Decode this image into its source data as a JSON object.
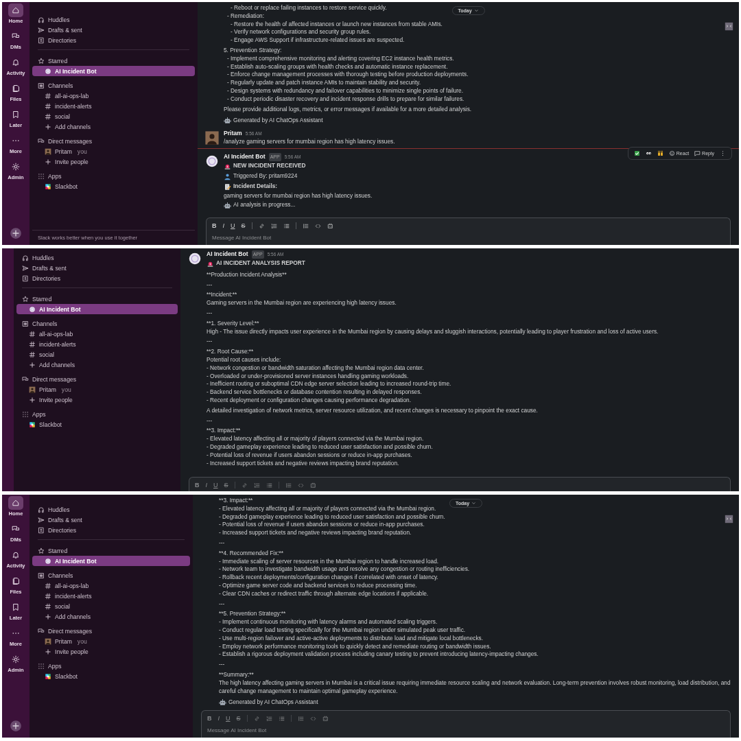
{
  "panels": [
    {
      "rail": [
        {
          "label": "Home",
          "kind": "home",
          "selected": true
        },
        {
          "label": "DMs",
          "kind": "dms",
          "selected": false
        },
        {
          "label": "Activity",
          "kind": "activity",
          "selected": false
        },
        {
          "label": "Files",
          "kind": "files",
          "selected": false
        },
        {
          "label": "Later",
          "kind": "later",
          "selected": false
        },
        {
          "label": "More",
          "kind": "more",
          "selected": false
        },
        {
          "label": "Admin",
          "kind": "admin",
          "selected": false
        }
      ],
      "sidebar": {
        "nav": [
          {
            "label": "Huddles",
            "kind": "huddles"
          },
          {
            "label": "Drafts & sent",
            "kind": "drafts"
          },
          {
            "label": "Directories",
            "kind": "directories"
          }
        ],
        "sections": [
          {
            "title": "Starred",
            "kind": "starred",
            "items": [
              {
                "label": "AI Incident Bot",
                "kind": "bot",
                "selected": true
              }
            ]
          },
          {
            "title": "Channels",
            "kind": "channels",
            "items": [
              {
                "label": "all-ai-ops-lab",
                "kind": "channel",
                "selected": false
              },
              {
                "label": "incident-alerts",
                "kind": "channel",
                "selected": false
              },
              {
                "label": "social",
                "kind": "channel",
                "selected": false
              },
              {
                "label": "Add channels",
                "kind": "add",
                "selected": false
              }
            ]
          },
          {
            "title": "Direct messages",
            "kind": "dms",
            "items": [
              {
                "label": "Pritam",
                "suffix": "you",
                "kind": "user",
                "selected": false
              },
              {
                "label": "Invite people",
                "kind": "add",
                "selected": false
              }
            ]
          },
          {
            "title": "Apps",
            "kind": "apps",
            "items": [
              {
                "label": "Slackbot",
                "kind": "app",
                "selected": false
              }
            ]
          }
        ],
        "footer": "Slack works better when you use it together"
      },
      "main": {
        "today": "Today",
        "side_button": true,
        "messages": [
          {
            "blocks": [
              {
                "lines": [
                  {
                    "text": "- Reboot or replace failing instances to restore service quickly.",
                    "kind": "subitem"
                  },
                  {
                    "text": "- Remediation:",
                    "kind": "item"
                  },
                  {
                    "text": "- Restore the health of affected instances or launch new instances from stable AMIs.",
                    "kind": "subitem"
                  },
                  {
                    "text": "- Verify network configurations and security group rules.",
                    "kind": "subitem"
                  },
                  {
                    "text": "- Engage AWS Support if infrastructure-related issues are suspected.",
                    "kind": "subitem"
                  }
                ]
              },
              {
                "lines": [
                  {
                    "text": "5. Prevention Strategy:",
                    "kind": "text"
                  },
                  {
                    "text": "- Implement comprehensive monitoring and alerting covering EC2 instance health metrics.",
                    "kind": "item"
                  },
                  {
                    "text": "- Establish auto-scaling groups with health checks and automatic instance replacement.",
                    "kind": "item"
                  },
                  {
                    "text": "- Enforce change management processes with thorough testing before production deployments.",
                    "kind": "item"
                  },
                  {
                    "text": "- Regularly update and patch instance AMIs to maintain stability and security.",
                    "kind": "item"
                  },
                  {
                    "text": "- Design systems with redundancy and failover capabilities to minimize single points of failure.",
                    "kind": "item"
                  },
                  {
                    "text": "- Conduct periodic disaster recovery and incident response drills to prepare for similar failures.",
                    "kind": "item"
                  }
                ]
              },
              {
                "lines": [
                  {
                    "text": "Please provide additional logs, metrics, or error messages if available for a more detailed analysis.",
                    "kind": "text"
                  }
                ]
              },
              {
                "lines": [
                  {
                    "text": "Generated by AI ChatOps Assistant",
                    "kind": "note"
                  }
                ]
              }
            ]
          },
          {
            "author": "Pritam",
            "kind": "user",
            "time": "5:56 AM",
            "new_divider": true,
            "blocks": [
              {
                "lines": [
                  {
                    "text": "/analyze gaming servers for mumbai region has high latency issues.",
                    "kind": "text"
                  }
                ]
              }
            ]
          },
          {
            "author": "AI Incident Bot",
            "badge": "APP",
            "kind": "bot",
            "time": "5:56 AM",
            "blocks": [
              {
                "lines": [
                  {
                    "text": "NEW INCIDENT RECEIVED",
                    "kind": "alert"
                  },
                  {
                    "text": "Triggered By: pritam9224",
                    "kind": "trigger"
                  },
                  {
                    "text": "Incident Details:",
                    "kind": "details"
                  },
                  {
                    "text": "gaming servers for mumbai region has high latency issues.",
                    "kind": "text"
                  },
                  {
                    "text": "AI analysis in progress...",
                    "kind": "note"
                  }
                ]
              }
            ],
            "actions": [
              {
                "kind": "check"
              },
              {
                "kind": "eyes"
              },
              {
                "kind": "hands"
              },
              {
                "kind": "react",
                "label": "React"
              },
              {
                "kind": "reply",
                "label": "Reply"
              },
              {
                "kind": "kebab"
              }
            ]
          }
        ],
        "composer": {
          "disabled": false,
          "placeholder": "Message AI Incident Bot",
          "tools": [
            {
              "kind": "bold",
              "label": "B"
            },
            {
              "kind": "italic",
              "label": "I"
            },
            {
              "kind": "underline",
              "label": "U"
            },
            {
              "kind": "strike",
              "label": "S"
            },
            {
              "kind": "link"
            },
            {
              "kind": "olist"
            },
            {
              "kind": "ulist"
            },
            {
              "kind": "quote"
            },
            {
              "kind": "code"
            },
            {
              "kind": "codeblock"
            }
          ]
        }
      }
    },
    {
      "sidebar": {
        "nav": [
          {
            "label": "Huddles",
            "kind": "huddles"
          },
          {
            "label": "Drafts & sent",
            "kind": "drafts"
          },
          {
            "label": "Directories",
            "kind": "directories"
          }
        ],
        "sections": [
          {
            "title": "Starred",
            "kind": "starred",
            "items": [
              {
                "label": "AI Incident Bot",
                "kind": "bot",
                "selected": true
              }
            ]
          },
          {
            "title": "Channels",
            "kind": "channels",
            "items": [
              {
                "label": "all-ai-ops-lab",
                "kind": "channel",
                "selected": false
              },
              {
                "label": "incident-alerts",
                "kind": "channel",
                "selected": false
              },
              {
                "label": "social",
                "kind": "channel",
                "selected": false
              },
              {
                "label": "Add channels",
                "kind": "add",
                "selected": false
              }
            ]
          },
          {
            "title": "Direct messages",
            "kind": "dms",
            "items": [
              {
                "label": "Pritam",
                "suffix": "you",
                "kind": "user",
                "selected": false
              },
              {
                "label": "Invite people",
                "kind": "add",
                "selected": false
              }
            ]
          },
          {
            "title": "Apps",
            "kind": "apps",
            "items": [
              {
                "label": "Slackbot",
                "kind": "app",
                "selected": false
              }
            ]
          }
        ]
      },
      "main": {
        "messages": [
          {
            "author": "AI Incident Bot",
            "badge": "APP",
            "kind": "bot",
            "time": "5:56 AM",
            "blocks": [
              {
                "lines": [
                  {
                    "text": "AI INCIDENT ANALYSIS REPORT",
                    "kind": "alert"
                  }
                ]
              },
              {
                "lines": [
                  {
                    "text": "**Production Incident Analysis**",
                    "kind": "text"
                  }
                ]
              },
              {
                "lines": [
                  {
                    "text": "---",
                    "kind": "text"
                  }
                ]
              },
              {
                "lines": [
                  {
                    "text": "**Incident:**",
                    "kind": "text"
                  },
                  {
                    "text": "Gaming servers in the Mumbai region are experiencing high latency issues.",
                    "kind": "text"
                  }
                ]
              },
              {
                "lines": [
                  {
                    "text": "---",
                    "kind": "text"
                  }
                ]
              },
              {
                "lines": [
                  {
                    "text": "**1. Severity Level:**",
                    "kind": "text"
                  },
                  {
                    "text": "High - The issue directly impacts user experience in the Mumbai region by causing delays and sluggish interactions, potentially leading to player frustration and loss of active users.",
                    "kind": "text"
                  }
                ]
              },
              {
                "lines": [
                  {
                    "text": "---",
                    "kind": "text"
                  }
                ]
              },
              {
                "lines": [
                  {
                    "text": "**2. Root Cause:**",
                    "kind": "text"
                  },
                  {
                    "text": "Potential root causes include:",
                    "kind": "text"
                  },
                  {
                    "text": "- Network congestion or bandwidth saturation affecting the Mumbai region data center.",
                    "kind": "text"
                  },
                  {
                    "text": "- Overloaded or under-provisioned server instances handling gaming workloads.",
                    "kind": "text"
                  },
                  {
                    "text": "- Inefficient routing or suboptimal CDN edge server selection leading to increased round-trip time.",
                    "kind": "text"
                  },
                  {
                    "text": "- Backend service bottlenecks or database contention resulting in delayed responses.",
                    "kind": "text"
                  },
                  {
                    "text": "- Recent deployment or configuration changes causing performance degradation.",
                    "kind": "text"
                  }
                ]
              },
              {
                "lines": [
                  {
                    "text": "A detailed investigation of network metrics, server resource utilization, and recent changes is necessary to pinpoint the exact cause.",
                    "kind": "text"
                  }
                ]
              },
              {
                "lines": [
                  {
                    "text": "---",
                    "kind": "text"
                  }
                ]
              },
              {
                "lines": [
                  {
                    "text": "**3. Impact:**",
                    "kind": "text"
                  },
                  {
                    "text": "- Elevated latency affecting all or majority of players connected via the Mumbai region.",
                    "kind": "text"
                  },
                  {
                    "text": "- Degraded gameplay experience leading to reduced user satisfaction and possible churn.",
                    "kind": "text"
                  },
                  {
                    "text": "- Potential loss of revenue if users abandon sessions or reduce in-app purchases.",
                    "kind": "text"
                  },
                  {
                    "text": "- Increased support tickets and negative reviews impacting brand reputation.",
                    "kind": "text"
                  }
                ]
              }
            ]
          }
        ],
        "composer": {
          "disabled": true,
          "tools": [
            {
              "kind": "bold",
              "label": "B"
            },
            {
              "kind": "italic",
              "label": "I"
            },
            {
              "kind": "underline",
              "label": "U"
            },
            {
              "kind": "strike",
              "label": "S"
            },
            {
              "kind": "link"
            },
            {
              "kind": "olist"
            },
            {
              "kind": "ulist"
            },
            {
              "kind": "quote"
            },
            {
              "kind": "code"
            },
            {
              "kind": "codeblock"
            }
          ]
        }
      }
    },
    {
      "rail": [
        {
          "label": "Home",
          "kind": "home",
          "selected": true
        },
        {
          "label": "DMs",
          "kind": "dms",
          "selected": false
        },
        {
          "label": "Activity",
          "kind": "activity",
          "selected": false
        },
        {
          "label": "Files",
          "kind": "files",
          "selected": false
        },
        {
          "label": "Later",
          "kind": "later",
          "selected": false
        },
        {
          "label": "More",
          "kind": "more",
          "selected": false
        },
        {
          "label": "Admin",
          "kind": "admin",
          "selected": false
        }
      ],
      "sidebar": {
        "nav": [
          {
            "label": "Huddles",
            "kind": "huddles"
          },
          {
            "label": "Drafts & sent",
            "kind": "drafts"
          },
          {
            "label": "Directories",
            "kind": "directories"
          }
        ],
        "sections": [
          {
            "title": "Starred",
            "kind": "starred",
            "items": [
              {
                "label": "AI Incident Bot",
                "kind": "bot",
                "selected": true
              }
            ]
          },
          {
            "title": "Channels",
            "kind": "channels",
            "items": [
              {
                "label": "all-ai-ops-lab",
                "kind": "channel",
                "selected": false
              },
              {
                "label": "incident-alerts",
                "kind": "channel",
                "selected": false
              },
              {
                "label": "social",
                "kind": "channel",
                "selected": false
              },
              {
                "label": "Add channels",
                "kind": "add",
                "selected": false
              }
            ]
          },
          {
            "title": "Direct messages",
            "kind": "dms",
            "items": [
              {
                "label": "Pritam",
                "suffix": "you",
                "kind": "user",
                "selected": false
              },
              {
                "label": "Invite people",
                "kind": "add",
                "selected": false
              }
            ]
          },
          {
            "title": "Apps",
            "kind": "apps",
            "items": [
              {
                "label": "Slackbot",
                "kind": "app",
                "selected": false
              }
            ]
          }
        ]
      },
      "main": {
        "today": "Today",
        "side_button": true,
        "messages": [
          {
            "blocks": [
              {
                "lines": [
                  {
                    "text": "**3. Impact:**",
                    "kind": "text"
                  },
                  {
                    "text": "- Elevated latency affecting all or majority of players connected via the Mumbai region.",
                    "kind": "text"
                  },
                  {
                    "text": "- Degraded gameplay experience leading to reduced user satisfaction and possible churn.",
                    "kind": "text"
                  },
                  {
                    "text": "- Potential loss of revenue if users abandon sessions or reduce in-app purchases.",
                    "kind": "text"
                  },
                  {
                    "text": "- Increased support tickets and negative reviews impacting brand reputation.",
                    "kind": "text"
                  }
                ]
              },
              {
                "lines": [
                  {
                    "text": "---",
                    "kind": "text"
                  }
                ]
              },
              {
                "lines": [
                  {
                    "text": "**4. Recommended Fix:**",
                    "kind": "text"
                  },
                  {
                    "text": "- Immediate scaling of server resources in the Mumbai region to handle increased load.",
                    "kind": "text"
                  },
                  {
                    "text": "- Network team to investigate bandwidth usage and resolve any congestion or routing inefficiencies.",
                    "kind": "text"
                  },
                  {
                    "text": "- Rollback recent deployments/configuration changes if correlated with onset of latency.",
                    "kind": "text"
                  },
                  {
                    "text": "- Optimize game server code and backend services to reduce processing time.",
                    "kind": "text"
                  },
                  {
                    "text": "- Clear CDN caches or redirect traffic through alternate edge locations if applicable.",
                    "kind": "text"
                  }
                ]
              },
              {
                "lines": [
                  {
                    "text": "---",
                    "kind": "text"
                  }
                ]
              },
              {
                "lines": [
                  {
                    "text": "**5. Prevention Strategy:**",
                    "kind": "text"
                  },
                  {
                    "text": "- Implement continuous monitoring with latency alarms and automated scaling triggers.",
                    "kind": "text"
                  },
                  {
                    "text": "- Conduct regular load testing specifically for the Mumbai region under simulated peak user traffic.",
                    "kind": "text"
                  },
                  {
                    "text": "- Use multi-region failover and active-active deployments to distribute load and mitigate local bottlenecks.",
                    "kind": "text"
                  },
                  {
                    "text": "- Employ network performance monitoring tools to quickly detect and remediate routing or bandwidth issues.",
                    "kind": "text"
                  },
                  {
                    "text": "- Establish a rigorous deployment validation process including canary testing to prevent introducing latency-impacting changes.",
                    "kind": "text"
                  }
                ]
              },
              {
                "lines": [
                  {
                    "text": "---",
                    "kind": "text"
                  }
                ]
              },
              {
                "lines": [
                  {
                    "text": "**Summary:**",
                    "kind": "text"
                  },
                  {
                    "text": "The high latency affecting gaming servers in Mumbai is a critical issue requiring immediate resource scaling and network evaluation. Long-term prevention involves robust monitoring, load distribution, and careful change management to maintain optimal gameplay experience.",
                    "kind": "text"
                  }
                ]
              },
              {
                "lines": [
                  {
                    "text": "Generated by AI ChatOps Assistant",
                    "kind": "note"
                  }
                ]
              }
            ]
          }
        ],
        "composer": {
          "disabled": true,
          "placeholder": "Message AI Incident Bot",
          "tools": [
            {
              "kind": "bold",
              "label": "B"
            },
            {
              "kind": "italic",
              "label": "I"
            },
            {
              "kind": "underline",
              "label": "U"
            },
            {
              "kind": "strike",
              "label": "S"
            },
            {
              "kind": "link"
            },
            {
              "kind": "olist"
            },
            {
              "kind": "ulist"
            },
            {
              "kind": "quote"
            },
            {
              "kind": "code"
            },
            {
              "kind": "codeblock"
            }
          ]
        }
      }
    }
  ]
}
